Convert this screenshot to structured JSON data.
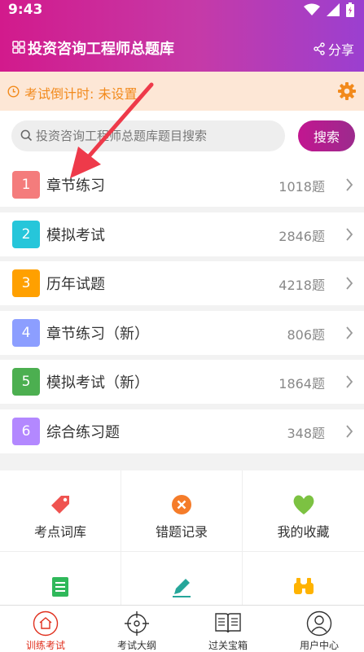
{
  "status_bar": {
    "time": "9:43"
  },
  "header": {
    "title": "投资咨询工程师总题库",
    "share_label": "分享"
  },
  "countdown": {
    "text": "考试倒计时: 未设置"
  },
  "search": {
    "placeholder": "投资咨询工程师总题库题目搜索",
    "button_label": "搜索"
  },
  "sections": [
    {
      "num": "1",
      "title": "章节练习",
      "count": "1018题",
      "color": "#f47c7c"
    },
    {
      "num": "2",
      "title": "模拟考试",
      "count": "2846题",
      "color": "#26c6da"
    },
    {
      "num": "3",
      "title": "历年试题",
      "count": "4218题",
      "color": "#ffa000"
    },
    {
      "num": "4",
      "title": "章节练习（新）",
      "count": "806题",
      "color": "#8c9eff"
    },
    {
      "num": "5",
      "title": "模拟考试（新）",
      "count": "1864题",
      "color": "#4caf50"
    },
    {
      "num": "6",
      "title": "综合练习题",
      "count": "348题",
      "color": "#b388ff"
    }
  ],
  "grid": [
    {
      "label": "考点词库",
      "icon": "tag-icon"
    },
    {
      "label": "错题记录",
      "icon": "wrong-circle-icon"
    },
    {
      "label": "我的收藏",
      "icon": "heart-icon"
    },
    {
      "label": "",
      "icon": "notebook-icon"
    },
    {
      "label": "",
      "icon": "pencil-icon"
    },
    {
      "label": "",
      "icon": "binoculars-icon"
    }
  ],
  "tabs": [
    {
      "label": "训练考试",
      "active": true
    },
    {
      "label": "考试大纲",
      "active": false
    },
    {
      "label": "过关宝箱",
      "active": false
    },
    {
      "label": "用户中心",
      "active": false
    }
  ]
}
